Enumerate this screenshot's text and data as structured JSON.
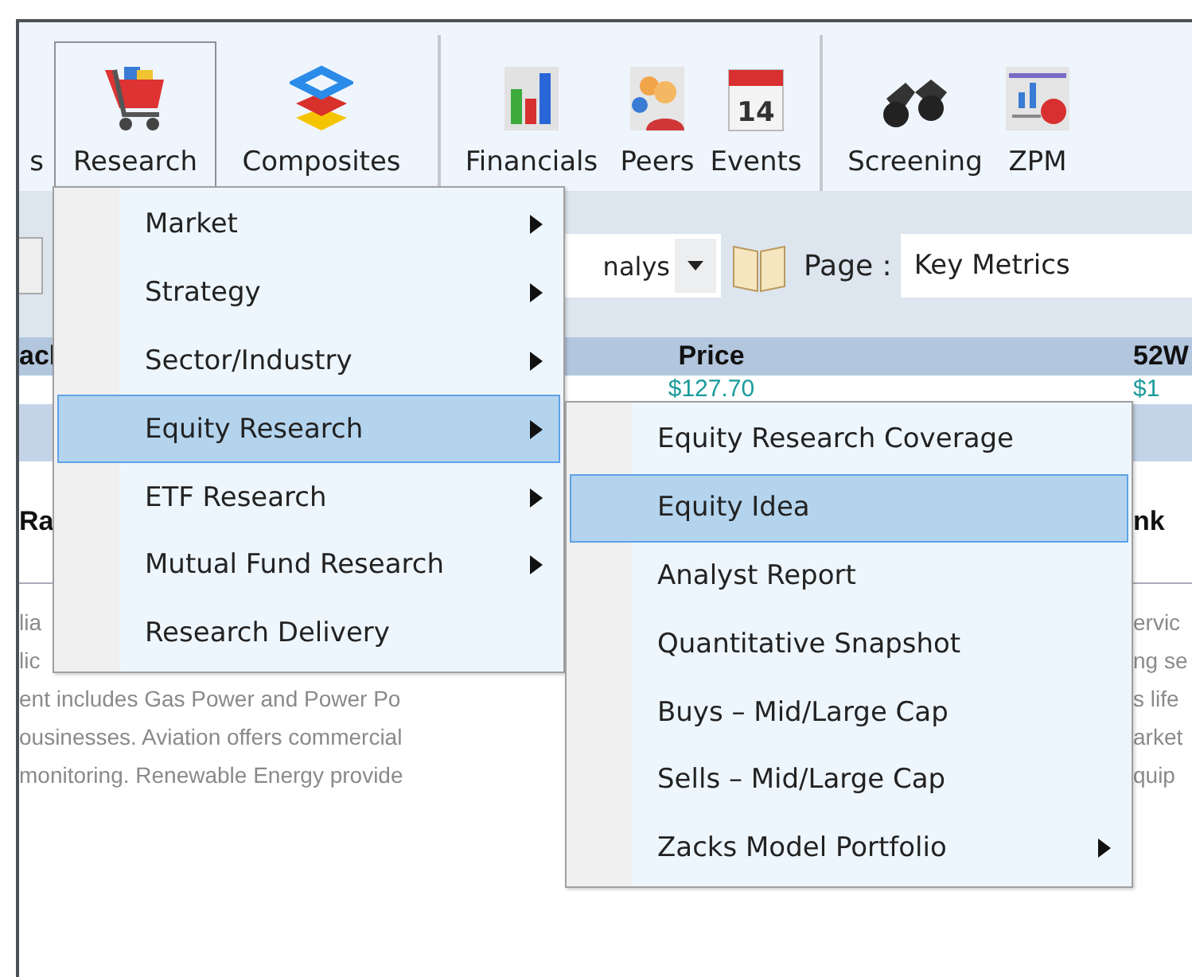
{
  "ribbon": {
    "items": [
      {
        "label": "s",
        "kind": "partial",
        "selected": false
      },
      {
        "label": "Research",
        "kind": "cart",
        "selected": true
      },
      {
        "label": "Composites",
        "kind": "layers",
        "selected": false
      },
      {
        "label": "Financials",
        "kind": "bars",
        "selected": false,
        "separator_before": true
      },
      {
        "label": "Peers",
        "kind": "people",
        "selected": false
      },
      {
        "label": "Events",
        "kind": "calendar",
        "badge": "14",
        "selected": false
      },
      {
        "label": "Screening",
        "kind": "binoculars",
        "selected": false,
        "separator_before": true
      },
      {
        "label": "ZPM",
        "kind": "report",
        "selected": false
      }
    ]
  },
  "toolbar": {
    "view_value": "nalys",
    "page_label": "Page :",
    "page_value": "Key Metrics"
  },
  "table": {
    "header": {
      "column_1": "acl",
      "price": "Price",
      "column_3": "52W"
    },
    "row": {
      "price": "$127.70",
      "column_3": "$1"
    },
    "subheader": {
      "column_1": "Ra",
      "column_3": "nk"
    },
    "description_left": [
      "lia",
      "lic",
      "ent includes Gas Power and Power Po",
      "ousinesses. Aviation offers commercial",
      "monitoring. Renewable Energy provide"
    ],
    "description_right": [
      "ervic",
      "ng se",
      "s life",
      "arket",
      "quip"
    ]
  },
  "menu": {
    "items": [
      {
        "label": "Market",
        "submenu": true,
        "selected": false
      },
      {
        "label": "Strategy",
        "submenu": true,
        "selected": false
      },
      {
        "label": "Sector/Industry",
        "submenu": true,
        "selected": false
      },
      {
        "label": "Equity Research",
        "submenu": true,
        "selected": true
      },
      {
        "label": "ETF Research",
        "submenu": true,
        "selected": false
      },
      {
        "label": "Mutual Fund Research",
        "submenu": true,
        "selected": false
      },
      {
        "label": "Research Delivery",
        "submenu": false,
        "selected": false
      }
    ]
  },
  "submenu": {
    "items": [
      {
        "label": "Equity Research Coverage",
        "submenu": false,
        "selected": false
      },
      {
        "label": "Equity Idea",
        "submenu": false,
        "selected": true
      },
      {
        "label": "Analyst Report",
        "submenu": false,
        "selected": false
      },
      {
        "label": "Quantitative Snapshot",
        "submenu": false,
        "selected": false
      },
      {
        "label": "Buys – Mid/Large Cap",
        "submenu": false,
        "selected": false
      },
      {
        "label": "Sells – Mid/Large Cap",
        "submenu": false,
        "selected": false
      },
      {
        "label": "Zacks Model Portfolio",
        "submenu": true,
        "selected": false
      }
    ]
  }
}
